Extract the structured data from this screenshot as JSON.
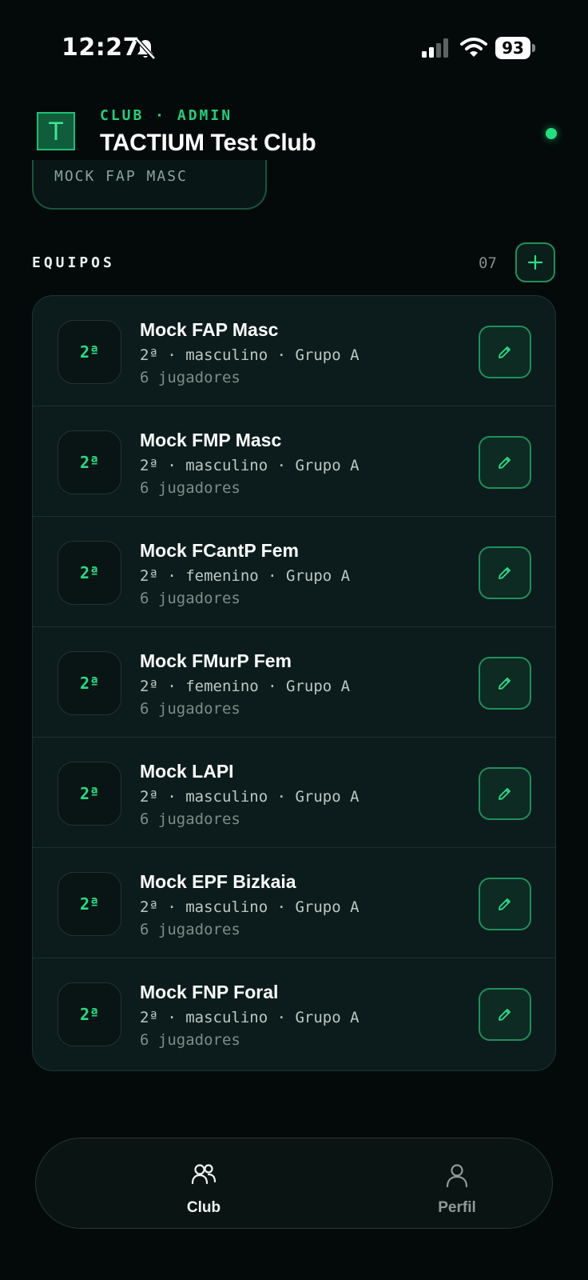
{
  "status_bar": {
    "time": "12:27",
    "battery": "93"
  },
  "header": {
    "kicker": "CLUB · ADMIN",
    "title": "TACTIUM Test Club",
    "logo_letter": "T"
  },
  "chip": {
    "label": "MOCK FAP MASC"
  },
  "section": {
    "title": "EQUIPOS",
    "count": "07"
  },
  "teams": [
    {
      "badge": "2ª",
      "name": "Mock FAP Masc",
      "meta": "2ª · masculino · Grupo A",
      "players": "6 jugadores"
    },
    {
      "badge": "2ª",
      "name": "Mock FMP Masc",
      "meta": "2ª · masculino · Grupo A",
      "players": "6 jugadores"
    },
    {
      "badge": "2ª",
      "name": "Mock FCantP Fem",
      "meta": "2ª · femenino · Grupo A",
      "players": "6 jugadores"
    },
    {
      "badge": "2ª",
      "name": "Mock FMurP Fem",
      "meta": "2ª · femenino · Grupo A",
      "players": "6 jugadores"
    },
    {
      "badge": "2ª",
      "name": "Mock LAPI",
      "meta": "2ª · masculino · Grupo A",
      "players": "6 jugadores"
    },
    {
      "badge": "2ª",
      "name": "Mock EPF Bizkaia",
      "meta": "2ª · masculino · Grupo A",
      "players": "6 jugadores"
    },
    {
      "badge": "2ª",
      "name": "Mock FNP Foral",
      "meta": "2ª · masculino · Grupo A",
      "players": "6 jugadores"
    }
  ],
  "tab_bar": {
    "club": "Club",
    "profile": "Perfil"
  },
  "colors": {
    "accent": "#22e07e",
    "background": "#040a0a",
    "card": "#0c1c1c"
  },
  "icons": {
    "silent": "bell-slash-icon",
    "signal": "cellular-signal-icon",
    "wifi": "wifi-icon",
    "add": "plus-icon",
    "edit": "pencil-icon",
    "club": "users-icon",
    "profile": "user-icon"
  }
}
